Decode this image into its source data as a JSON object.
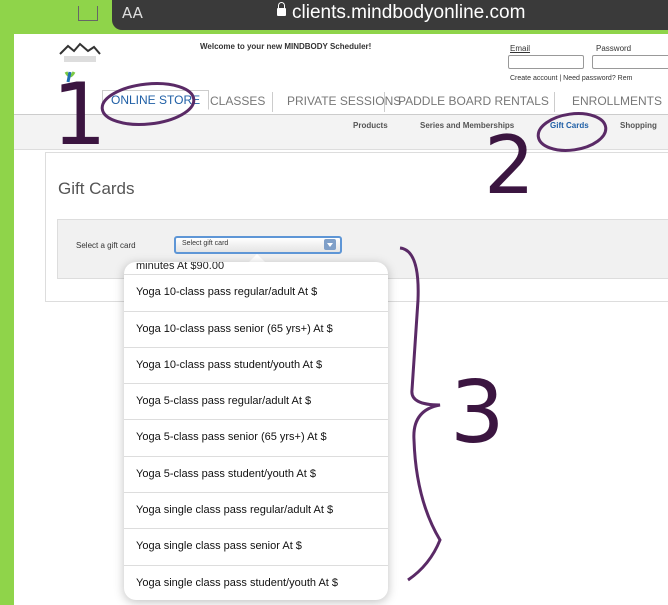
{
  "browser": {
    "text_size_label": "AA",
    "url": "clients.mindbodyonline.com"
  },
  "header": {
    "welcome": "Welcome to your new MINDBODY Scheduler!",
    "email_label": "Email",
    "password_label": "Password",
    "links": "Create account  | Need password?  Rem"
  },
  "tabs": [
    "ONLINE STORE",
    "CLASSES",
    "PRIVATE SESSIONS",
    "PADDLE BOARD RENTALS",
    "ENROLLMENTS"
  ],
  "subnav": [
    "Products",
    "Series and Memberships",
    "Gift Cards",
    "Shopping"
  ],
  "page": {
    "title": "Gift Cards",
    "select_label": "Select a gift card",
    "select_value": "Select gift card"
  },
  "dropdown": {
    "partial_item": "minutes At  $90.00",
    "items": [
      "Yoga 10-class pass regular/adult At  $",
      "Yoga 10-class pass senior (65 yrs+) At  $",
      "Yoga 10-class pass student/youth At  $",
      "Yoga 5-class pass regular/adult At  $",
      "Yoga 5-class pass senior (65 yrs+)  At  $",
      "Yoga 5-class pass student/youth At  $",
      "Yoga single class pass regular/adult At  $",
      "Yoga single class pass senior At  $",
      "Yoga single class pass student/youth At  $"
    ]
  },
  "annotations": {
    "step1": "1",
    "step2": "2",
    "step3": "3"
  },
  "colors": {
    "background": "#8fd44a",
    "accent": "#1f5fa6",
    "annotation": "#5a2a66"
  }
}
